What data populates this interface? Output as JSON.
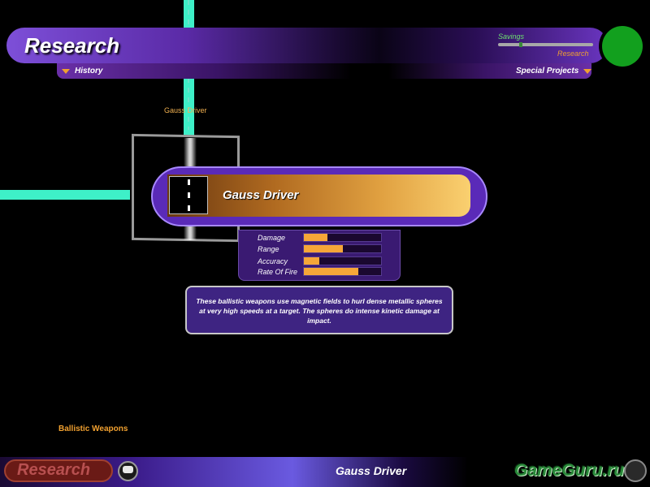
{
  "header": {
    "title": "Research",
    "history_label": "History",
    "special_projects_label": "Special Projects",
    "savings_label": "Savings",
    "research_label": "Research",
    "savings_split": 0.23
  },
  "tree": {
    "node_label": "Gauss Driver",
    "category": "Ballistic Weapons"
  },
  "item": {
    "name": "Gauss Driver",
    "stats": [
      {
        "label": "Damage",
        "value": 0.3
      },
      {
        "label": "Range",
        "value": 0.5
      },
      {
        "label": "Accuracy",
        "value": 0.2
      },
      {
        "label": "Rate Of Fire",
        "value": 0.7
      }
    ],
    "description": "These ballistic weapons use magnetic fields to hurl dense metallic spheres at very high speeds at a target.  The spheres do intense kinetic damage at impact."
  },
  "bottom": {
    "research_button": "Research",
    "title": "Gauss Driver",
    "watermark": "GameGuru.ru"
  },
  "colors": {
    "accent_orange": "#f0a030",
    "tree_line": "#3ef0c8",
    "panel_purple": "#3e2482",
    "orb_green": "#12a01e"
  }
}
